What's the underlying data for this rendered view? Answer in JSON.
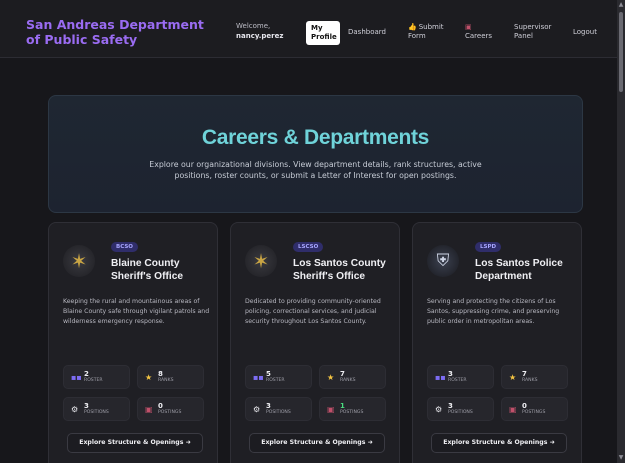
{
  "header": {
    "brand": "San Andreas Department of Public Safety",
    "welcome_label": "Welcome,",
    "username": "nancy.perez",
    "nav": {
      "my_profile": "My Profile",
      "dashboard": "Dashboard",
      "submit_form": "Submit Form",
      "careers": "Careers",
      "supervisor_panel": "Supervisor Panel",
      "logout": "Logout"
    }
  },
  "hero": {
    "title": "Careers & Departments",
    "subtitle": "Explore our organizational divisions. View department details, rank structures, active positions, roster counts, or submit a Letter of Interest for open postings."
  },
  "departments": [
    {
      "abbr": "BCSO",
      "name": "Blaine County Sheriff's Office",
      "logo_icon": "sheriff-star",
      "description": "Keeping the rural and mountainous areas of Blaine County safe through vigilant patrols and wilderness emergency response.",
      "stats": {
        "roster": "2",
        "roster_label": "ROSTER",
        "ranks": "8",
        "ranks_label": "RANKS",
        "positions": "3",
        "positions_label": "POSITIONS",
        "postings": "0",
        "postings_label": "POSTINGS"
      },
      "button": "Explore Structure & Openings ➜"
    },
    {
      "abbr": "LSCSO",
      "name": "Los Santos County Sheriff's Office",
      "logo_icon": "sheriff-star",
      "description": "Dedicated to providing community-oriented policing, correctional services, and judicial security throughout Los Santos County.",
      "stats": {
        "roster": "5",
        "roster_label": "ROSTER",
        "ranks": "7",
        "ranks_label": "RANKS",
        "positions": "3",
        "positions_label": "POSITIONS",
        "postings": "1",
        "postings_label": "POSTINGS"
      },
      "button": "Explore Structure & Openings ➜"
    },
    {
      "abbr": "LSPD",
      "name": "Los Santos Police Department",
      "logo_icon": "police-shield",
      "description": "Serving and protecting the citizens of Los Santos, suppressing crime, and preserving public order in metropolitan areas.",
      "stats": {
        "roster": "3",
        "roster_label": "ROSTER",
        "ranks": "7",
        "ranks_label": "RANKS",
        "positions": "3",
        "positions_label": "POSITIONS",
        "postings": "0",
        "postings_label": "POSTINGS"
      },
      "button": "Explore Structure & Openings ➜"
    }
  ],
  "colors": {
    "brand": "#9a6cf2",
    "hero_title": "#6fd3d9",
    "badge_bg": "#2f2d6a",
    "badge_text": "#a8a6ff",
    "postings_active": "#4ade80"
  }
}
